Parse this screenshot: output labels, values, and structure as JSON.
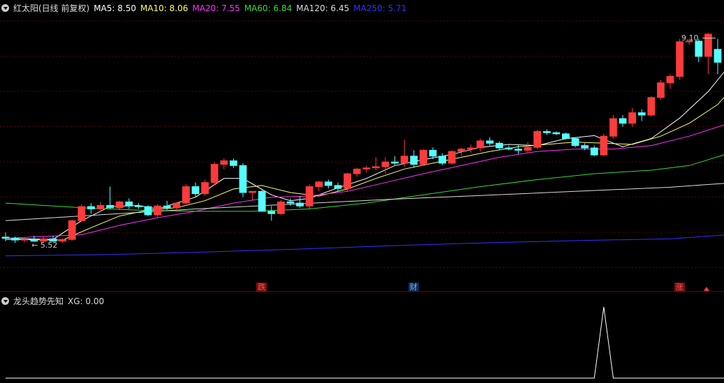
{
  "main_header": {
    "title": "红太阳(日线 前复权)",
    "ma": [
      {
        "label": "MA5: 8.50",
        "color": "#ffffff"
      },
      {
        "label": "MA10: 8.06",
        "color": "#ffff66"
      },
      {
        "label": "MA20: 7.55",
        "color": "#ff33ff"
      },
      {
        "label": "MA60: 6.84",
        "color": "#33dd33"
      },
      {
        "label": "MA120: 6.45",
        "color": "#dddddd"
      },
      {
        "label": "MA250: 5.71",
        "color": "#3333ff"
      }
    ]
  },
  "annotations": {
    "high_price": "9.10",
    "low_price": "5.52",
    "event_tags": [
      {
        "text": "跌",
        "color": "#ff5555",
        "bg": "#7a1010"
      },
      {
        "text": "财",
        "color": "#6fb8ff",
        "bg": "#102a55"
      },
      {
        "text": "涨",
        "color": "#ff5555",
        "bg": "#7a1010"
      }
    ]
  },
  "sub_header": {
    "title": "龙头趋势先知",
    "value_label": "XG: 0.00"
  },
  "colors": {
    "up": "#ff3b3b",
    "down": "#54ffff",
    "grid": "#5a0000",
    "signal": "#ffffff"
  },
  "chart_data": {
    "type": "candlestick",
    "candles": [
      {
        "o": 5.62,
        "h": 5.7,
        "l": 5.55,
        "c": 5.6
      },
      {
        "o": 5.6,
        "h": 5.63,
        "l": 5.52,
        "c": 5.57
      },
      {
        "o": 5.57,
        "h": 5.62,
        "l": 5.53,
        "c": 5.58
      },
      {
        "o": 5.58,
        "h": 5.64,
        "l": 5.54,
        "c": 5.55
      },
      {
        "o": 5.55,
        "h": 5.62,
        "l": 5.53,
        "c": 5.59
      },
      {
        "o": 5.59,
        "h": 5.64,
        "l": 5.54,
        "c": 5.55
      },
      {
        "o": 5.55,
        "h": 5.6,
        "l": 5.52,
        "c": 5.58
      },
      {
        "o": 5.58,
        "h": 5.92,
        "l": 5.56,
        "c": 5.9
      },
      {
        "o": 5.9,
        "h": 6.18,
        "l": 5.88,
        "c": 6.14
      },
      {
        "o": 6.14,
        "h": 6.2,
        "l": 6.02,
        "c": 6.1
      },
      {
        "o": 6.1,
        "h": 6.22,
        "l": 6.05,
        "c": 6.16
      },
      {
        "o": 6.16,
        "h": 6.48,
        "l": 6.1,
        "c": 6.12
      },
      {
        "o": 6.12,
        "h": 6.24,
        "l": 6.08,
        "c": 6.22
      },
      {
        "o": 6.22,
        "h": 6.28,
        "l": 6.1,
        "c": 6.15
      },
      {
        "o": 6.15,
        "h": 6.2,
        "l": 6.1,
        "c": 6.14
      },
      {
        "o": 6.14,
        "h": 6.16,
        "l": 5.98,
        "c": 6.0
      },
      {
        "o": 6.0,
        "h": 6.18,
        "l": 5.96,
        "c": 6.15
      },
      {
        "o": 6.15,
        "h": 6.24,
        "l": 6.08,
        "c": 6.12
      },
      {
        "o": 6.12,
        "h": 6.22,
        "l": 6.05,
        "c": 6.2
      },
      {
        "o": 6.2,
        "h": 6.52,
        "l": 6.18,
        "c": 6.48
      },
      {
        "o": 6.48,
        "h": 6.55,
        "l": 6.3,
        "c": 6.36
      },
      {
        "o": 6.36,
        "h": 6.6,
        "l": 6.32,
        "c": 6.55
      },
      {
        "o": 6.55,
        "h": 6.9,
        "l": 6.5,
        "c": 6.86
      },
      {
        "o": 6.86,
        "h": 6.96,
        "l": 6.78,
        "c": 6.92
      },
      {
        "o": 6.92,
        "h": 6.96,
        "l": 6.8,
        "c": 6.84
      },
      {
        "o": 6.84,
        "h": 6.88,
        "l": 6.3,
        "c": 6.38
      },
      {
        "o": 6.38,
        "h": 6.4,
        "l": 6.25,
        "c": 6.4
      },
      {
        "o": 6.4,
        "h": 6.42,
        "l": 6.06,
        "c": 6.06
      },
      {
        "o": 6.06,
        "h": 6.15,
        "l": 5.9,
        "c": 6.02
      },
      {
        "o": 6.02,
        "h": 6.25,
        "l": 6.0,
        "c": 6.22
      },
      {
        "o": 6.22,
        "h": 6.28,
        "l": 6.15,
        "c": 6.2
      },
      {
        "o": 6.2,
        "h": 6.32,
        "l": 6.12,
        "c": 6.15
      },
      {
        "o": 6.15,
        "h": 6.52,
        "l": 6.1,
        "c": 6.48
      },
      {
        "o": 6.48,
        "h": 6.58,
        "l": 6.4,
        "c": 6.56
      },
      {
        "o": 6.56,
        "h": 6.6,
        "l": 6.45,
        "c": 6.5
      },
      {
        "o": 6.5,
        "h": 6.55,
        "l": 6.4,
        "c": 6.45
      },
      {
        "o": 6.45,
        "h": 6.72,
        "l": 6.4,
        "c": 6.7
      },
      {
        "o": 6.7,
        "h": 6.8,
        "l": 6.65,
        "c": 6.78
      },
      {
        "o": 6.78,
        "h": 6.84,
        "l": 6.72,
        "c": 6.8
      },
      {
        "o": 6.8,
        "h": 6.98,
        "l": 6.76,
        "c": 6.82
      },
      {
        "o": 6.82,
        "h": 6.98,
        "l": 6.7,
        "c": 6.9
      },
      {
        "o": 6.9,
        "h": 7.0,
        "l": 6.85,
        "c": 6.88
      },
      {
        "o": 6.88,
        "h": 7.28,
        "l": 6.82,
        "c": 7.0
      },
      {
        "o": 7.0,
        "h": 7.1,
        "l": 6.8,
        "c": 6.86
      },
      {
        "o": 6.86,
        "h": 7.12,
        "l": 6.84,
        "c": 7.1
      },
      {
        "o": 7.1,
        "h": 7.15,
        "l": 6.95,
        "c": 7.0
      },
      {
        "o": 7.0,
        "h": 7.05,
        "l": 6.85,
        "c": 6.88
      },
      {
        "o": 6.88,
        "h": 7.1,
        "l": 6.86,
        "c": 7.08
      },
      {
        "o": 7.08,
        "h": 7.14,
        "l": 7.0,
        "c": 7.12
      },
      {
        "o": 7.12,
        "h": 7.2,
        "l": 7.06,
        "c": 7.14
      },
      {
        "o": 7.14,
        "h": 7.3,
        "l": 7.08,
        "c": 7.26
      },
      {
        "o": 7.26,
        "h": 7.32,
        "l": 7.18,
        "c": 7.22
      },
      {
        "o": 7.22,
        "h": 7.25,
        "l": 7.1,
        "c": 7.14
      },
      {
        "o": 7.14,
        "h": 7.18,
        "l": 7.1,
        "c": 7.12
      },
      {
        "o": 7.12,
        "h": 7.2,
        "l": 7.04,
        "c": 7.1
      },
      {
        "o": 7.1,
        "h": 7.24,
        "l": 7.06,
        "c": 7.15
      },
      {
        "o": 7.15,
        "h": 7.45,
        "l": 7.12,
        "c": 7.42
      },
      {
        "o": 7.42,
        "h": 7.46,
        "l": 7.36,
        "c": 7.4
      },
      {
        "o": 7.4,
        "h": 7.42,
        "l": 7.36,
        "c": 7.38
      },
      {
        "o": 7.38,
        "h": 7.4,
        "l": 7.28,
        "c": 7.3
      },
      {
        "o": 7.3,
        "h": 7.32,
        "l": 7.15,
        "c": 7.18
      },
      {
        "o": 7.18,
        "h": 7.22,
        "l": 7.1,
        "c": 7.14
      },
      {
        "o": 7.14,
        "h": 7.18,
        "l": 7.0,
        "c": 7.02
      },
      {
        "o": 7.02,
        "h": 7.38,
        "l": 7.0,
        "c": 7.34
      },
      {
        "o": 7.34,
        "h": 7.7,
        "l": 7.3,
        "c": 7.64
      },
      {
        "o": 7.64,
        "h": 7.7,
        "l": 7.5,
        "c": 7.56
      },
      {
        "o": 7.56,
        "h": 7.82,
        "l": 7.5,
        "c": 7.74
      },
      {
        "o": 7.74,
        "h": 7.8,
        "l": 7.6,
        "c": 7.7
      },
      {
        "o": 7.7,
        "h": 8.02,
        "l": 7.68,
        "c": 8.0
      },
      {
        "o": 8.0,
        "h": 8.3,
        "l": 7.96,
        "c": 8.25
      },
      {
        "o": 8.25,
        "h": 8.4,
        "l": 8.15,
        "c": 8.36
      },
      {
        "o": 8.36,
        "h": 9.0,
        "l": 8.3,
        "c": 8.95
      },
      {
        "o": 8.95,
        "h": 9.0,
        "l": 8.9,
        "c": 8.96
      },
      {
        "o": 8.96,
        "h": 9.0,
        "l": 8.6,
        "c": 8.7
      },
      {
        "o": 8.7,
        "h": 9.1,
        "l": 8.4,
        "c": 9.08
      },
      {
        "o": 8.82,
        "h": 9.0,
        "l": 8.4,
        "c": 8.6
      }
    ],
    "moving_averages": [
      {
        "name": "MA5",
        "color": "#ffffff",
        "points": [
          [
            0,
            5.6
          ],
          [
            5,
            5.58
          ],
          [
            8,
            5.9
          ],
          [
            11,
            6.14
          ],
          [
            14,
            6.16
          ],
          [
            16,
            6.1
          ],
          [
            20,
            6.3
          ],
          [
            23,
            6.62
          ],
          [
            25,
            6.62
          ],
          [
            28,
            6.34
          ],
          [
            30,
            6.24
          ],
          [
            32,
            6.28
          ],
          [
            35,
            6.46
          ],
          [
            38,
            6.62
          ],
          [
            41,
            6.84
          ],
          [
            44,
            6.94
          ],
          [
            47,
            7.03
          ],
          [
            50,
            7.15
          ],
          [
            53,
            7.2
          ],
          [
            56,
            7.18
          ],
          [
            59,
            7.3
          ],
          [
            62,
            7.35
          ],
          [
            65,
            7.16
          ],
          [
            68,
            7.3
          ],
          [
            71,
            7.65
          ],
          [
            74,
            8.1
          ],
          [
            76,
            8.5
          ]
        ]
      },
      {
        "name": "MA10",
        "color": "#ffff66",
        "points": [
          [
            0,
            5.58
          ],
          [
            6,
            5.57
          ],
          [
            9,
            5.78
          ],
          [
            12,
            5.98
          ],
          [
            15,
            6.08
          ],
          [
            18,
            6.12
          ],
          [
            21,
            6.24
          ],
          [
            24,
            6.44
          ],
          [
            27,
            6.5
          ],
          [
            30,
            6.38
          ],
          [
            33,
            6.32
          ],
          [
            36,
            6.44
          ],
          [
            39,
            6.62
          ],
          [
            42,
            6.78
          ],
          [
            45,
            6.88
          ],
          [
            48,
            6.98
          ],
          [
            51,
            7.08
          ],
          [
            54,
            7.16
          ],
          [
            57,
            7.2
          ],
          [
            60,
            7.24
          ],
          [
            63,
            7.22
          ],
          [
            66,
            7.2
          ],
          [
            69,
            7.34
          ],
          [
            72,
            7.56
          ],
          [
            75,
            7.88
          ],
          [
            76,
            8.06
          ]
        ]
      },
      {
        "name": "MA20",
        "color": "#ff33ff",
        "points": [
          [
            0,
            5.6
          ],
          [
            8,
            5.66
          ],
          [
            12,
            5.82
          ],
          [
            16,
            5.95
          ],
          [
            20,
            6.06
          ],
          [
            24,
            6.2
          ],
          [
            28,
            6.3
          ],
          [
            32,
            6.32
          ],
          [
            36,
            6.4
          ],
          [
            40,
            6.55
          ],
          [
            44,
            6.7
          ],
          [
            48,
            6.84
          ],
          [
            52,
            6.98
          ],
          [
            56,
            7.08
          ],
          [
            60,
            7.12
          ],
          [
            64,
            7.12
          ],
          [
            68,
            7.18
          ],
          [
            72,
            7.34
          ],
          [
            76,
            7.55
          ]
        ]
      },
      {
        "name": "MA60",
        "color": "#33dd33",
        "points": [
          [
            0,
            6.2
          ],
          [
            8,
            6.12
          ],
          [
            14,
            6.08
          ],
          [
            20,
            6.06
          ],
          [
            26,
            6.06
          ],
          [
            32,
            6.1
          ],
          [
            38,
            6.2
          ],
          [
            44,
            6.34
          ],
          [
            50,
            6.48
          ],
          [
            56,
            6.6
          ],
          [
            62,
            6.7
          ],
          [
            68,
            6.76
          ],
          [
            72,
            6.84
          ],
          [
            76,
            7.04
          ]
        ]
      },
      {
        "name": "MA120",
        "color": "#dddddd",
        "points": [
          [
            0,
            5.9
          ],
          [
            10,
            6.0
          ],
          [
            20,
            6.1
          ],
          [
            30,
            6.18
          ],
          [
            40,
            6.26
          ],
          [
            50,
            6.33
          ],
          [
            60,
            6.4
          ],
          [
            70,
            6.47
          ],
          [
            76,
            6.54
          ]
        ]
      },
      {
        "name": "MA250",
        "color": "#3333ff",
        "points": [
          [
            0,
            5.3
          ],
          [
            10,
            5.32
          ],
          [
            20,
            5.36
          ],
          [
            30,
            5.41
          ],
          [
            40,
            5.47
          ],
          [
            50,
            5.52
          ],
          [
            60,
            5.56
          ],
          [
            70,
            5.59
          ],
          [
            76,
            5.66
          ]
        ]
      }
    ],
    "event_tag_indices": [
      27,
      43,
      71
    ],
    "signal_xg": [
      0,
      0,
      0,
      0,
      0,
      0,
      0,
      0,
      0,
      0,
      0,
      0,
      0,
      0,
      0,
      0,
      0,
      0,
      0,
      0,
      0,
      0,
      0,
      0,
      0,
      0,
      0,
      0,
      0,
      0,
      0,
      0,
      0,
      0,
      0,
      0,
      0,
      0,
      0,
      0,
      0,
      0,
      0,
      0,
      0,
      0,
      0,
      0,
      0,
      0,
      0,
      0,
      0,
      0,
      0,
      0,
      0,
      0,
      0,
      0,
      0,
      0,
      0,
      1,
      0,
      0,
      0,
      0,
      0,
      0,
      0,
      0,
      0,
      0,
      0,
      0,
      0
    ],
    "price_range": [
      5.0,
      9.4
    ],
    "high_index": 75,
    "low_index": 2
  }
}
